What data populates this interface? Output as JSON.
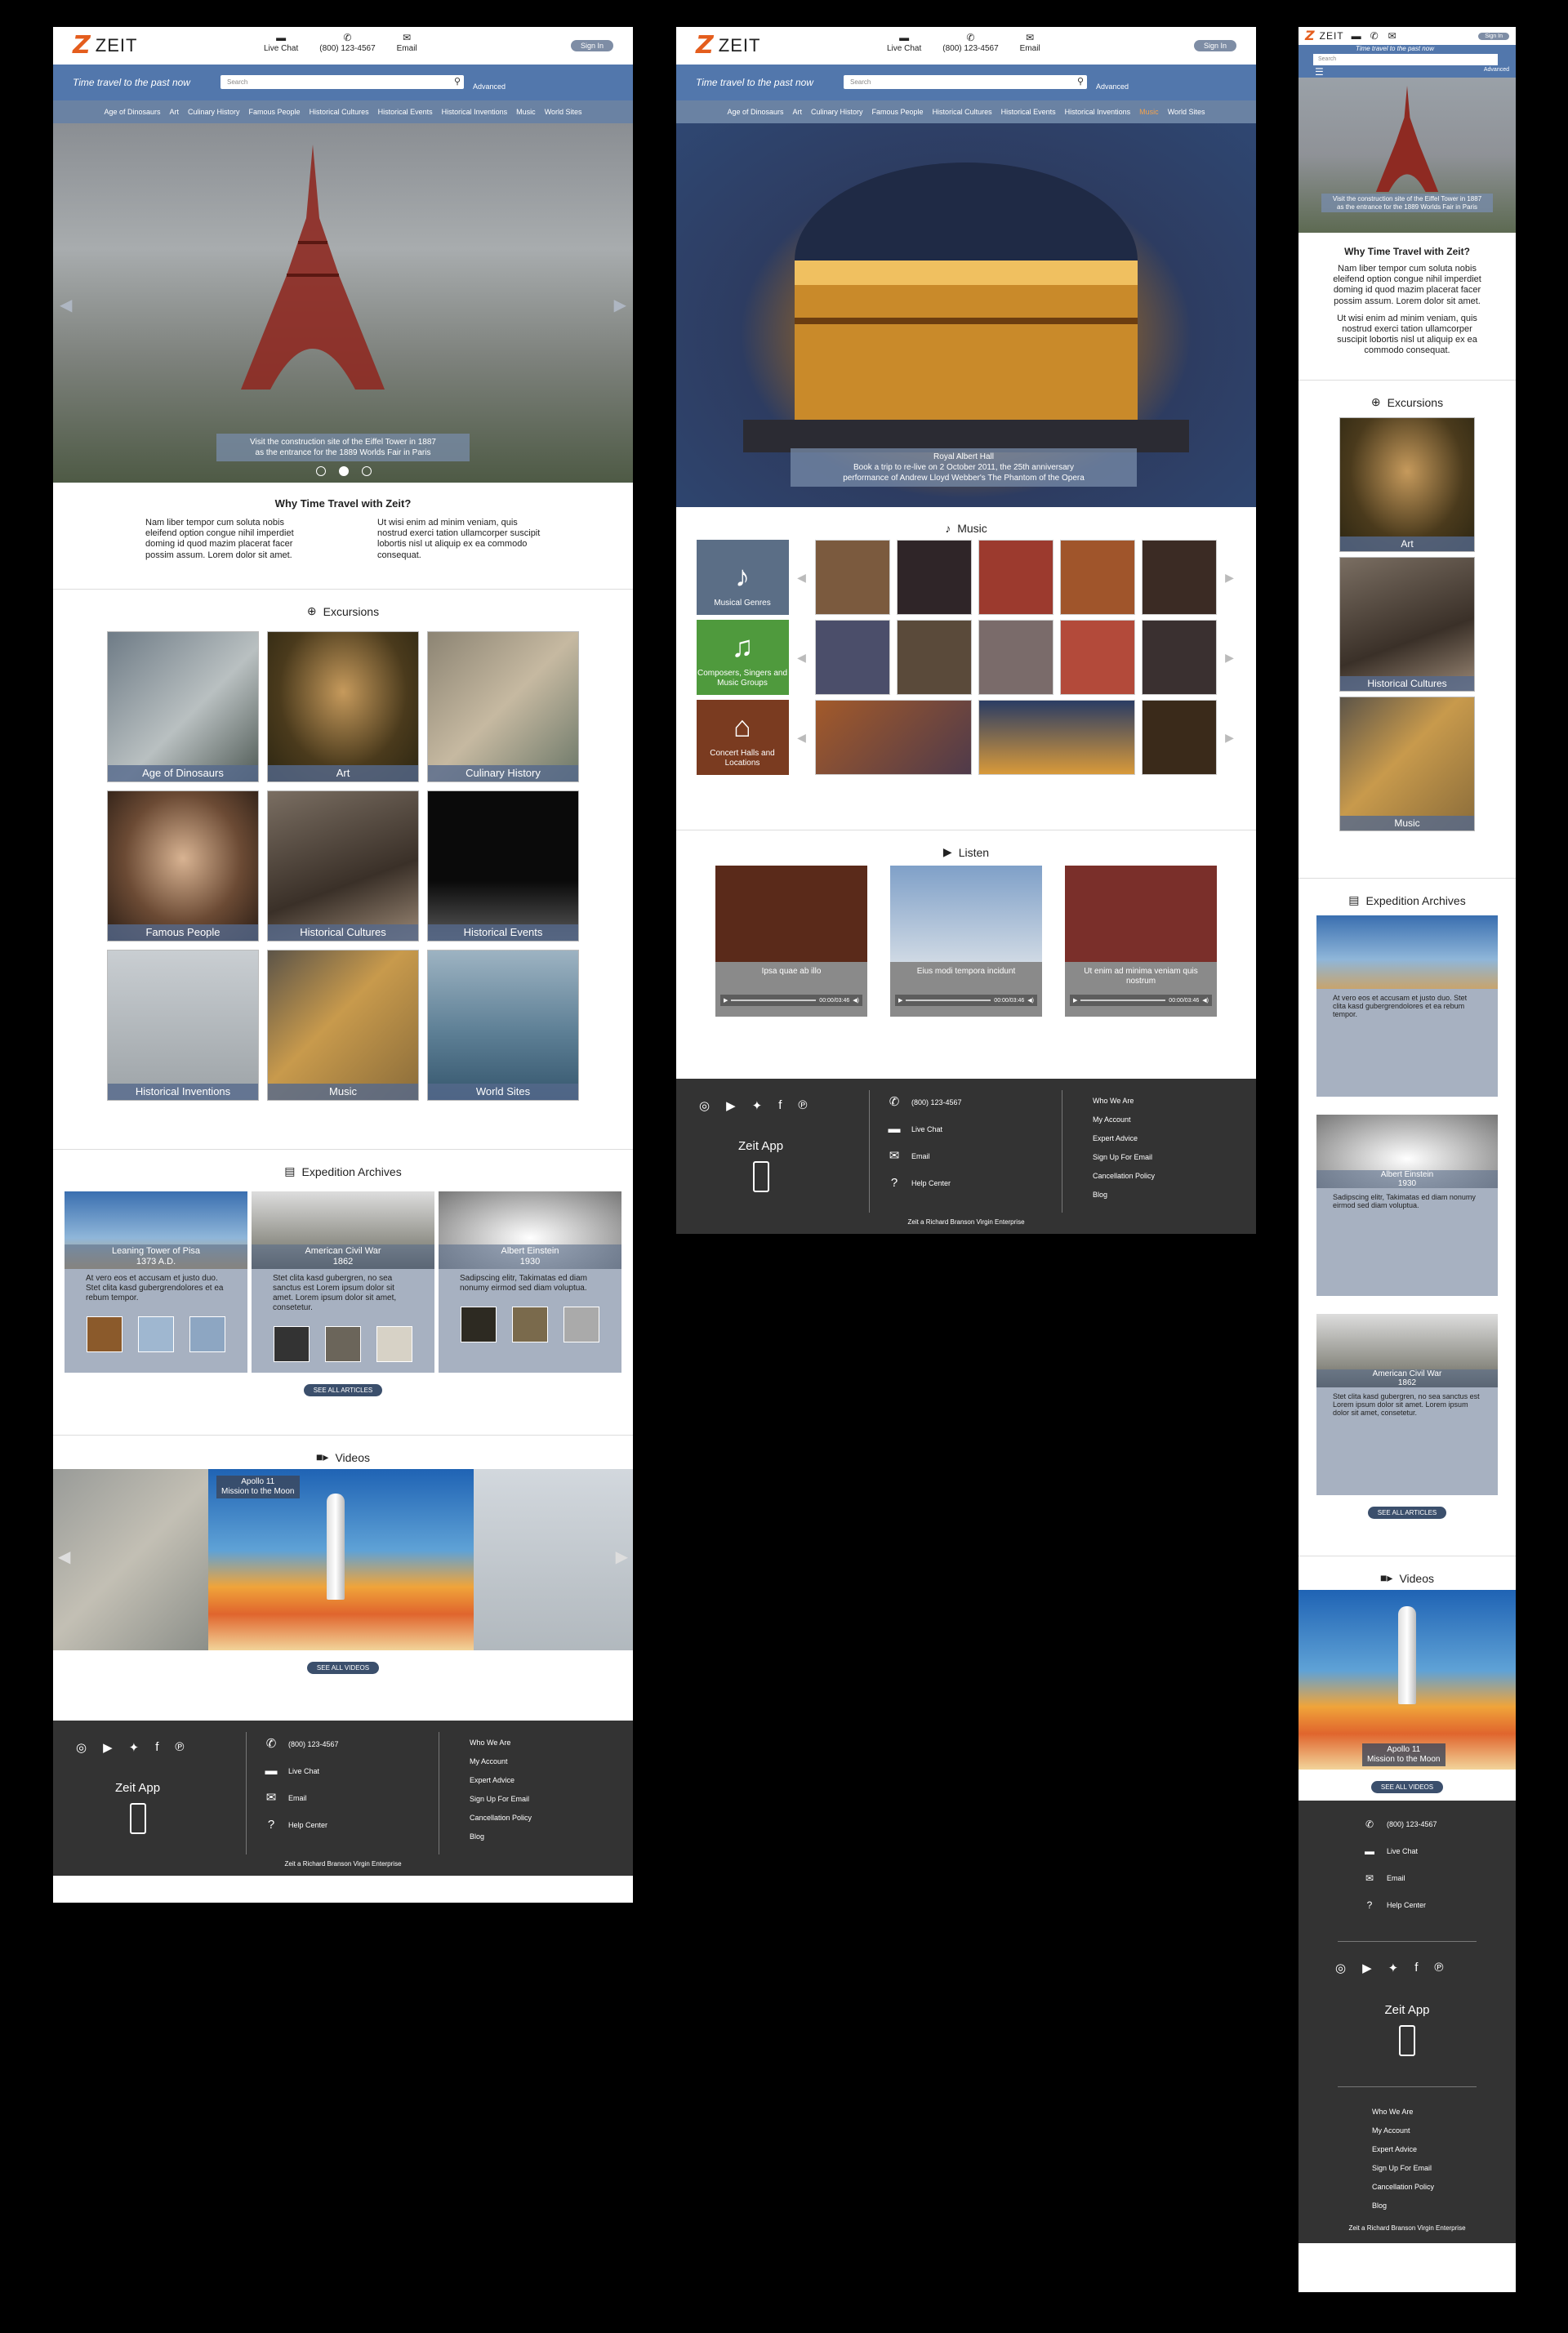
{
  "brand": {
    "mark": "Z",
    "name": "ZEIT"
  },
  "header": {
    "live_chat": "Live Chat",
    "phone": "(800) 123-4567",
    "email": "Email",
    "sign_in": "Sign In",
    "tagline": "Time travel to the past now",
    "search_placeholder": "Search",
    "advanced": "Advanced"
  },
  "nav": [
    "Age of Dinosaurs",
    "Art",
    "Culinary History",
    "Famous People",
    "Historical Cultures",
    "Historical Events",
    "Historical Inventions",
    "Music",
    "World Sites"
  ],
  "hero1": {
    "caption_1": "Visit the construction site of the Eiffel Tower in 1887",
    "caption_2": "as the entrance for the 1889 Worlds Fair in Paris"
  },
  "hero2": {
    "caption_1": "Royal Albert Hall",
    "caption_2": "Book a trip to re-live on 2 October 2011, the 25th anniversary",
    "caption_3": "performance of Andrew Lloyd Webber's The Phantom of the Opera"
  },
  "hero_mobile": {
    "caption_1": "Visit the construction site of the Eiffel Tower in 1887",
    "caption_2": "as the entrance for the 1889 Worlds Fair in Paris"
  },
  "why": {
    "title": "Why Time Travel with Zeit?",
    "col1": "Nam liber tempor cum soluta nobis eleifend option congue nihil imperdiet doming id quod mazim placerat facer possim assum. Lorem dolor sit amet.",
    "col2": "Ut wisi enim ad minim veniam, quis nostrud exerci tation ullamcorper suscipit lobortis nisl ut aliquip ex ea commodo consequat."
  },
  "excursions": {
    "title": "Excursions",
    "tiles": [
      "Age of Dinosaurs",
      "Art",
      "Culinary History",
      "Famous People",
      "Historical Cultures",
      "Historical Events",
      "Historical Inventions",
      "Music",
      "World Sites"
    ]
  },
  "archives": {
    "title": "Expedition Archives",
    "cards": [
      {
        "title": "Leaning Tower of Pisa",
        "date": "1373 A.D.",
        "text": "At vero eos et accusam et justo duo. Stet clita kasd gubergrendolores et ea rebum tempor."
      },
      {
        "title": "American Civil War",
        "date": "1862",
        "text": "Stet clita kasd gubergren, no sea sanctus est Lorem ipsum dolor sit amet. Lorem ipsum dolor sit amet, consetetur."
      },
      {
        "title": "Albert Einstein",
        "date": "1930",
        "text": "Sadipscing elitr, Takimatas ed diam nonumy eirmod sed diam voluptua."
      }
    ],
    "see_all": "SEE ALL ARTICLES"
  },
  "videos": {
    "title": "Videos",
    "caption_1": "Apollo 11",
    "caption_2": "Mission to the Moon",
    "see_all": "SEE ALL VIDEOS"
  },
  "music": {
    "title": "Music",
    "cats": [
      "Musical Genres",
      "Composers, Singers and Music Groups",
      "Concert Halls and Locations"
    ]
  },
  "listen": {
    "title": "Listen",
    "tracks": [
      "Ipsa quae ab illo",
      "Eius modi tempora incidunt",
      "Ut enim ad minima veniam quis nostrum"
    ],
    "time": "00:00/03:46"
  },
  "footer": {
    "app": "Zeit App",
    "phone": "(800) 123-4567",
    "chat": "Live Chat",
    "email": "Email",
    "help": "Help Center",
    "links": [
      "Who We Are",
      "My Account",
      "Expert Advice",
      "Sign Up For Email",
      "Cancellation Policy",
      "Blog"
    ],
    "copy": "Zeit a Richard Branson Virgin Enterprise"
  },
  "colors": {
    "brand_orange": "#e45d1d",
    "blue_bar": "#5277ac",
    "nav": "#6a82a3",
    "active_nav": "#f2a24e",
    "footer": "#333333"
  }
}
